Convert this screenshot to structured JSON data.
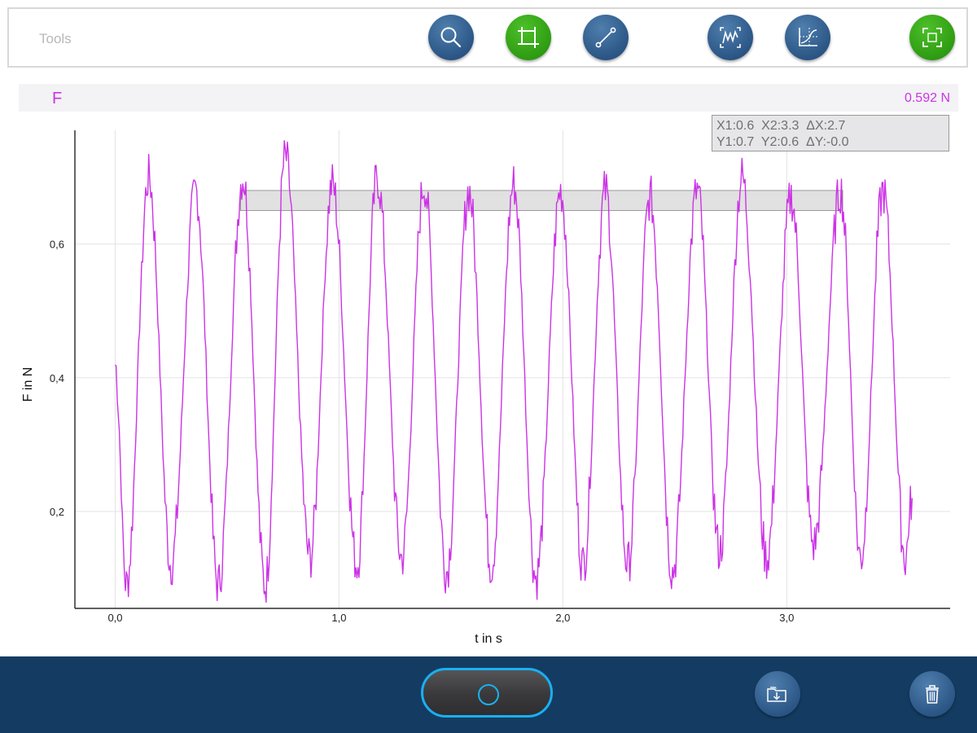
{
  "toolbar": {
    "label": "Tools",
    "buttons": [
      {
        "name": "zoom-button",
        "icon": "magnifier-icon",
        "color": "blue"
      },
      {
        "name": "crop-button",
        "icon": "crop-icon",
        "color": "green"
      },
      {
        "name": "line-tool-button",
        "icon": "line-segment-icon",
        "color": "blue"
      },
      {
        "name": "autoscale-button",
        "icon": "waveform-fit-icon",
        "color": "blue"
      },
      {
        "name": "curve-fit-button",
        "icon": "graph-fit-icon",
        "color": "blue"
      },
      {
        "name": "fullscreen-button",
        "icon": "expand-icon",
        "color": "green"
      }
    ]
  },
  "sensor": {
    "name": "F",
    "value": "0.592 N",
    "color": "#cc33e6"
  },
  "cursor_readout": {
    "line1": "X1:0.6  X2:3.3  ΔX:2.7",
    "line2": "Y1:0.7  Y2:0.6  ΔY:-0.0"
  },
  "chart_data": {
    "type": "line",
    "xlabel": "t in s",
    "ylabel": "F in N",
    "xlim": [
      -0.18,
      3.73
    ],
    "ylim": [
      0.055,
      0.77
    ],
    "xticks": [
      0.0,
      1.0,
      2.0,
      3.0
    ],
    "xtick_labels": [
      "0,0",
      "1,0",
      "2,0",
      "3,0"
    ],
    "yticks": [
      0.2,
      0.4,
      0.6
    ],
    "ytick_labels": [
      "0,2",
      "0,4",
      "0,6"
    ],
    "grid": true,
    "series": [
      {
        "color": "#cc33e6",
        "x_start": 0.0,
        "x_end": 3.56,
        "peaks_x": [
          0.15,
          0.36,
          0.57,
          0.76,
          0.97,
          1.17,
          1.38,
          1.58,
          1.78,
          1.99,
          2.19,
          2.39,
          2.6,
          2.8,
          3.02,
          3.24,
          3.43
        ],
        "peaks_y": [
          0.7,
          0.68,
          0.7,
          0.73,
          0.69,
          0.7,
          0.69,
          0.68,
          0.69,
          0.68,
          0.68,
          0.67,
          0.68,
          0.7,
          0.67,
          0.68,
          0.68
        ],
        "troughs_x": [
          0.05,
          0.25,
          0.46,
          0.67,
          0.87,
          1.08,
          1.28,
          1.48,
          1.68,
          1.88,
          2.09,
          2.29,
          2.49,
          2.7,
          2.91,
          3.12,
          3.33,
          3.53
        ],
        "troughs_y": [
          0.09,
          0.12,
          0.09,
          0.09,
          0.13,
          0.12,
          0.13,
          0.11,
          0.12,
          0.1,
          0.12,
          0.12,
          0.11,
          0.14,
          0.13,
          0.15,
          0.13,
          0.13
        ]
      }
    ],
    "cursor_band": {
      "x1": 0.56,
      "x2": 3.25,
      "y_low": 0.65,
      "y_high": 0.68
    }
  },
  "bottom": {
    "record_icon": "record-circle-icon",
    "export_icon": "folder-download-icon",
    "delete_icon": "trash-icon"
  }
}
